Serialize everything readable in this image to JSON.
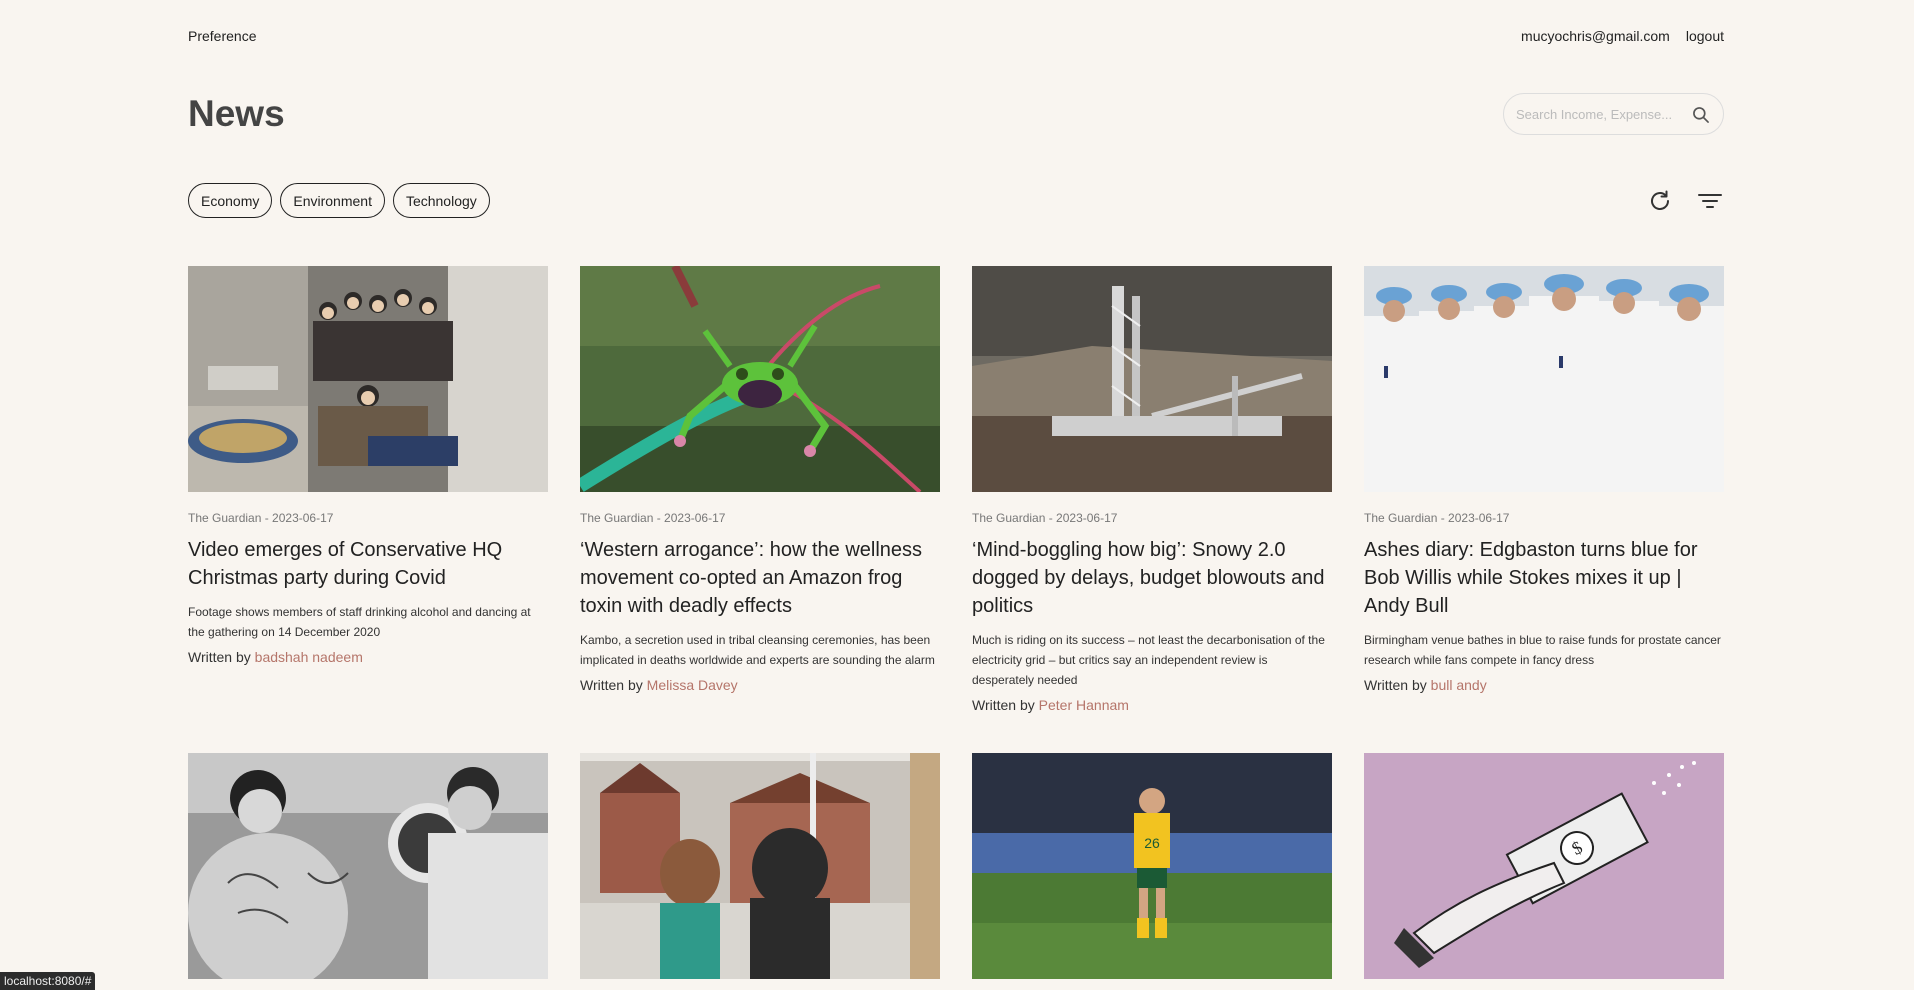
{
  "topbar": {
    "preference": "Preference",
    "email": "mucyochris@gmail.com",
    "logout": "logout"
  },
  "page": {
    "title": "News"
  },
  "search": {
    "placeholder": "Search Income, Expense..."
  },
  "chips": [
    "Economy",
    "Environment",
    "Technology"
  ],
  "written_by": "Written by",
  "articles": [
    {
      "meta": "The Guardian - 2023-06-17",
      "headline": "Video emerges of Conservative HQ Christmas party during Covid",
      "summary": "Footage shows members of staff drinking alcohol and dancing at the gathering on 14 December 2020",
      "author": "badshah nadeem"
    },
    {
      "meta": "The Guardian - 2023-06-17",
      "headline": "‘Western arrogance’: how the wellness movement co-opted an Amazon frog toxin with deadly effects",
      "summary": "Kambo, a secretion used in tribal cleansing ceremonies, has been implicated in deaths worldwide and experts are sounding the alarm",
      "author": "Melissa Davey"
    },
    {
      "meta": "The Guardian - 2023-06-17",
      "headline": "‘Mind-boggling how big’: Snowy 2.0 dogged by delays, budget blowouts and politics",
      "summary": "Much is riding on its success – not least the decarbonisation of the electricity grid – but critics say an independent review is desperately needed",
      "author": "Peter Hannam"
    },
    {
      "meta": "The Guardian - 2023-06-17",
      "headline": "Ashes diary: Edgbaston turns blue for Bob Willis while Stokes mixes it up | Andy Bull",
      "summary": "Birmingham venue bathes in blue to raise funds for prostate cancer research while fans compete in fancy dress",
      "author": "bull andy"
    }
  ],
  "status_bar": "localhost:8080/#",
  "colors": {
    "background": "#f9f5f0",
    "author_link": "#b5756a"
  },
  "icons": [
    "search-icon",
    "refresh-icon",
    "filter-icon"
  ]
}
